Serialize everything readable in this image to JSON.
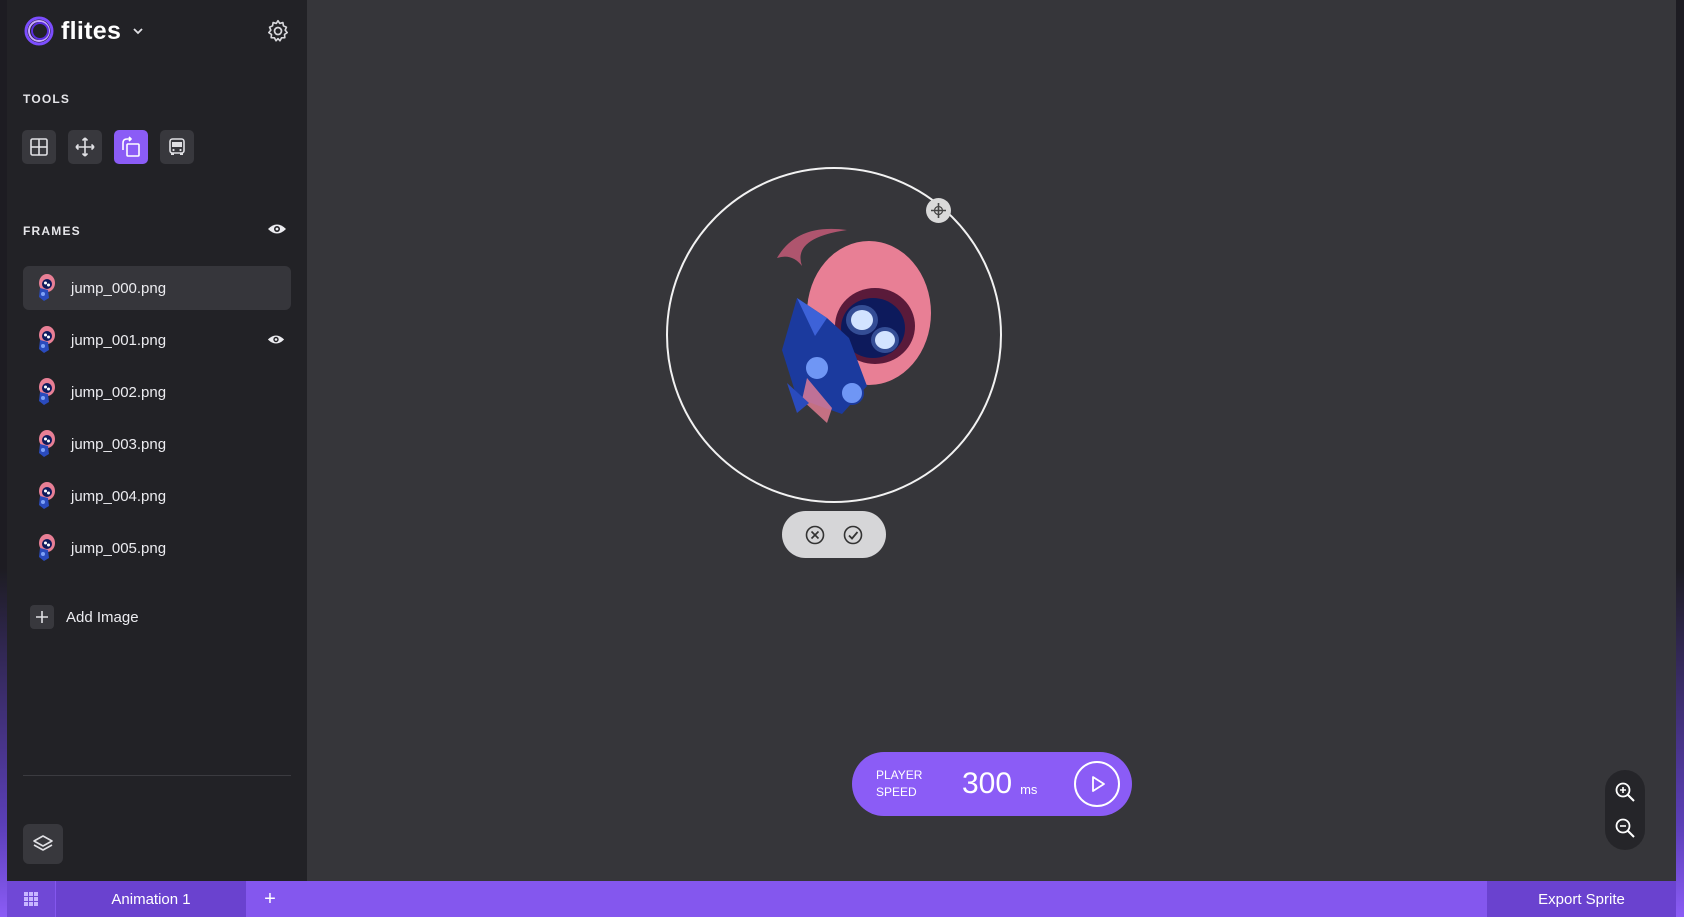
{
  "app": {
    "name": "flites",
    "name_icon": "chevron-down-icon"
  },
  "sidebar": {
    "tools_label": "TOOLS",
    "tools": [
      {
        "name": "grid-icon",
        "active": false
      },
      {
        "name": "move-icon",
        "active": false
      },
      {
        "name": "rotate-icon",
        "active": true
      },
      {
        "name": "bus-icon",
        "active": false
      }
    ],
    "frames_label": "FRAMES",
    "frames": [
      {
        "label": "jump_000.png",
        "selected": true,
        "visible_icon": false
      },
      {
        "label": "jump_001.png",
        "selected": false,
        "visible_icon": true
      },
      {
        "label": "jump_002.png",
        "selected": false,
        "visible_icon": false
      },
      {
        "label": "jump_003.png",
        "selected": false,
        "visible_icon": false
      },
      {
        "label": "jump_004.png",
        "selected": false,
        "visible_icon": false
      },
      {
        "label": "jump_005.png",
        "selected": false,
        "visible_icon": false
      }
    ],
    "add_image_label": "Add Image"
  },
  "player": {
    "label_line1": "PLAYER",
    "label_line2": "SPEED",
    "value": "300",
    "unit": "ms"
  },
  "bottombar": {
    "tab_label": "Animation 1",
    "add_tab_label": "+",
    "export_label": "Export Sprite"
  },
  "colors": {
    "accent": "#8b5cf6",
    "sidebar": "#222226",
    "canvas": "#36363a"
  }
}
